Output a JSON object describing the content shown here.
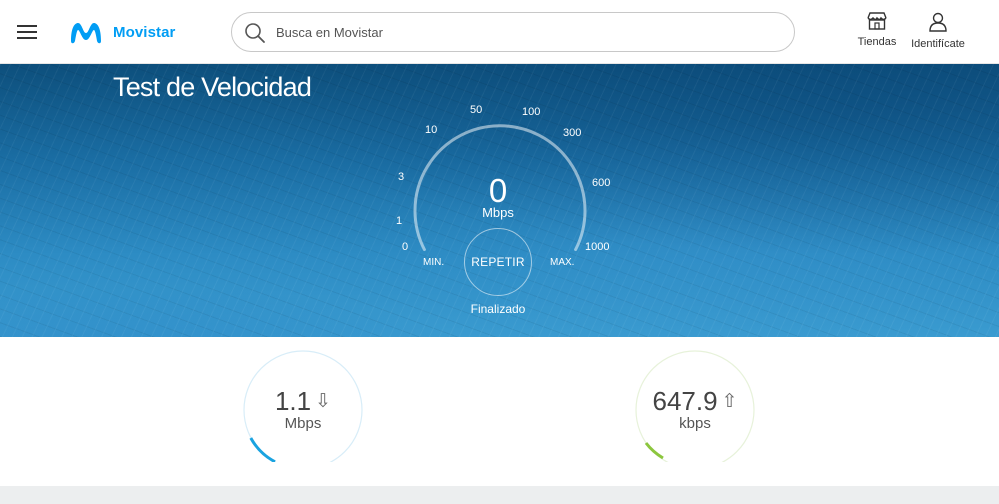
{
  "header": {
    "brand": "Movistar",
    "search_placeholder": "Busca en Movistar",
    "stores_label": "Tiendas",
    "login_label": "Identifícate",
    "icons": [
      "menu-icon",
      "movistar-logo-icon",
      "search-icon",
      "store-icon",
      "user-icon"
    ]
  },
  "hero": {
    "title": "Test de Velocidad",
    "gauge": {
      "scale_labels": [
        "0",
        "1",
        "3",
        "10",
        "50",
        "100",
        "300",
        "600",
        "1000"
      ],
      "value": "0",
      "unit": "Mbps",
      "min_label": "MIN.",
      "max_label": "MAX.",
      "repeat_label": "REPETIR",
      "status": "Finalizado"
    }
  },
  "results": {
    "download": {
      "value": "1.1",
      "unit": "Mbps",
      "icon": "arrow-down-icon",
      "ring_color": "#1aa3e0"
    },
    "upload": {
      "value": "647.9",
      "unit": "kbps",
      "icon": "arrow-up-icon",
      "ring_color": "#8cc63e"
    }
  },
  "colors": {
    "brand": "#019df4",
    "hero_dark": "#0d4f7c",
    "hero_light": "#3a9bd0"
  }
}
